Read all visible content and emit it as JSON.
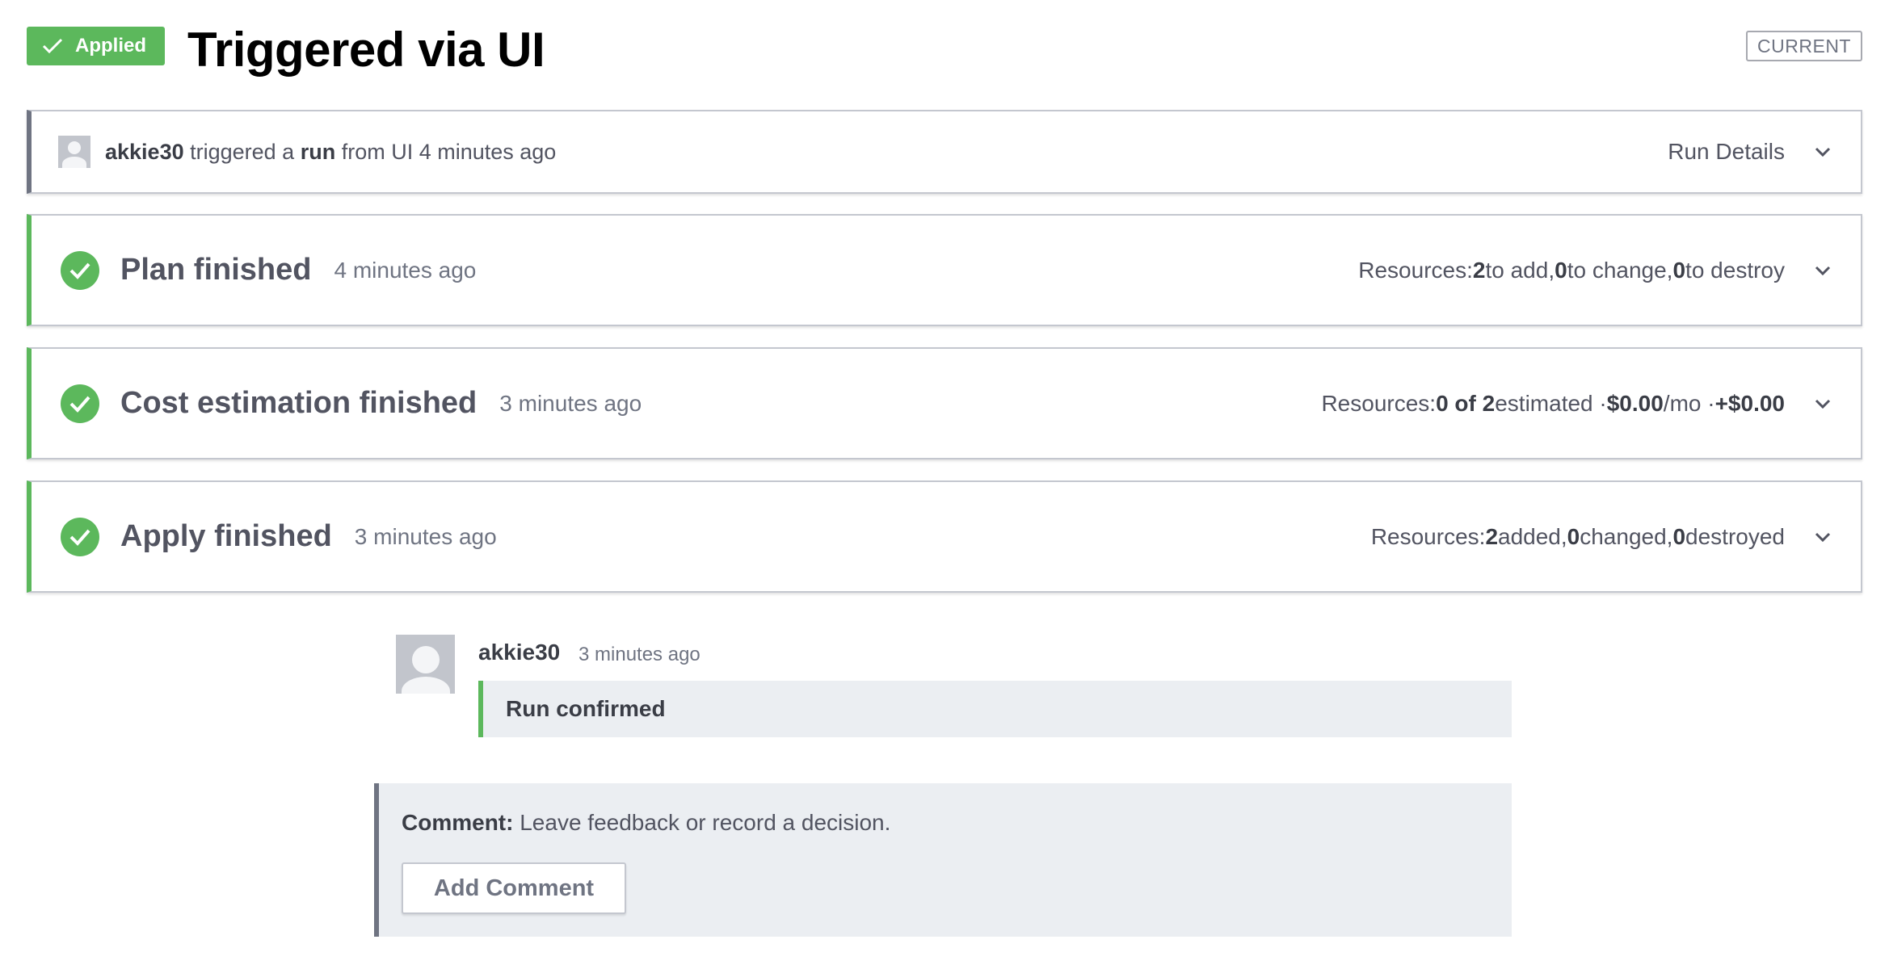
{
  "header": {
    "status_badge": "Applied",
    "title": "Triggered via UI",
    "current_tag": "CURRENT"
  },
  "run": {
    "user": "akkie30",
    "text_triggered": " triggered a ",
    "run_word": "run",
    "text_from": " from UI 4 minutes ago",
    "details_label": "Run Details"
  },
  "plan": {
    "title": "Plan finished",
    "time": "4 minutes ago",
    "resources_label": "Resources: ",
    "add_count": "2",
    "add_text": " to add, ",
    "change_count": "0",
    "change_text": " to change, ",
    "destroy_count": "0",
    "destroy_text": " to destroy"
  },
  "cost": {
    "title": "Cost estimation finished",
    "time": "3 minutes ago",
    "resources_label": "Resources: ",
    "estimated_count": "0 of 2",
    "estimated_text": " estimated · ",
    "monthly": "$0.00",
    "monthly_suffix": "/mo · ",
    "delta": "+$0.00"
  },
  "apply": {
    "title": "Apply finished",
    "time": "3 minutes ago",
    "resources_label": "Resources: ",
    "added_count": "2",
    "added_text": " added, ",
    "changed_count": "0",
    "changed_text": " changed, ",
    "destroyed_count": "0",
    "destroyed_text": " destroyed"
  },
  "comment_entry": {
    "author": "akkie30",
    "time": "3 minutes ago",
    "message": "Run confirmed"
  },
  "comment_form": {
    "label": "Comment:",
    "prompt": " Leave feedback or record a decision.",
    "button_label": "Add Comment"
  },
  "colors": {
    "success": "#5cb85c",
    "neutral": "#6f7482",
    "panel_bg": "#ebeef2"
  },
  "icons": {
    "badge": "check-icon",
    "step_status": "check-circle-icon",
    "expand": "chevron-down-icon",
    "user": "avatar-placeholder"
  }
}
